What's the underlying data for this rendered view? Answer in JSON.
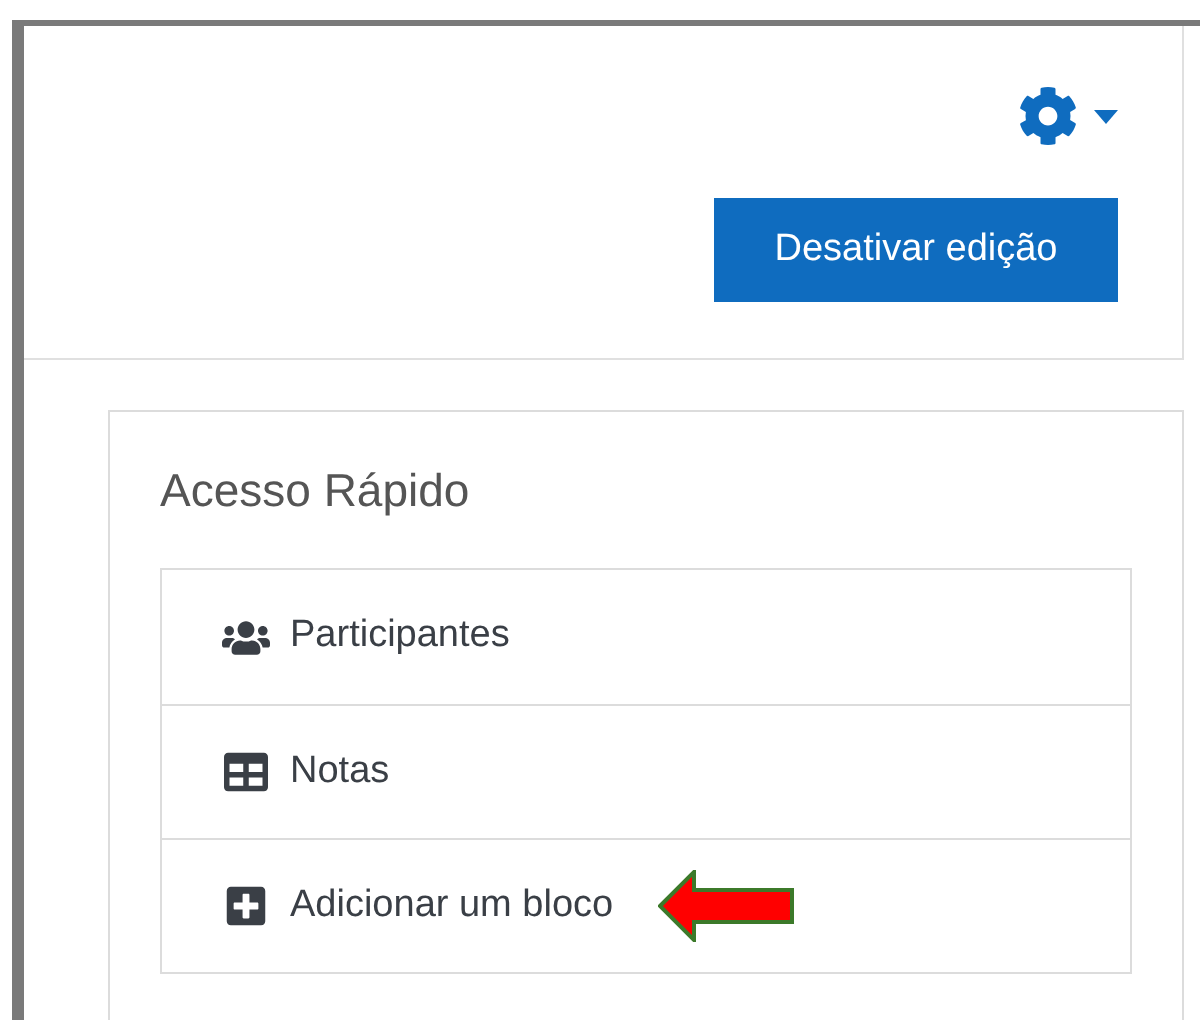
{
  "header": {
    "button": "Desativar edição"
  },
  "block": {
    "title": "Acesso Rápido",
    "items": [
      {
        "kind": "participants",
        "label": "Participantes",
        "highlighted": false
      },
      {
        "kind": "grades",
        "label": "Notas",
        "highlighted": false
      },
      {
        "kind": "add",
        "label": "Adicionar um bloco",
        "highlighted": true
      }
    ]
  }
}
